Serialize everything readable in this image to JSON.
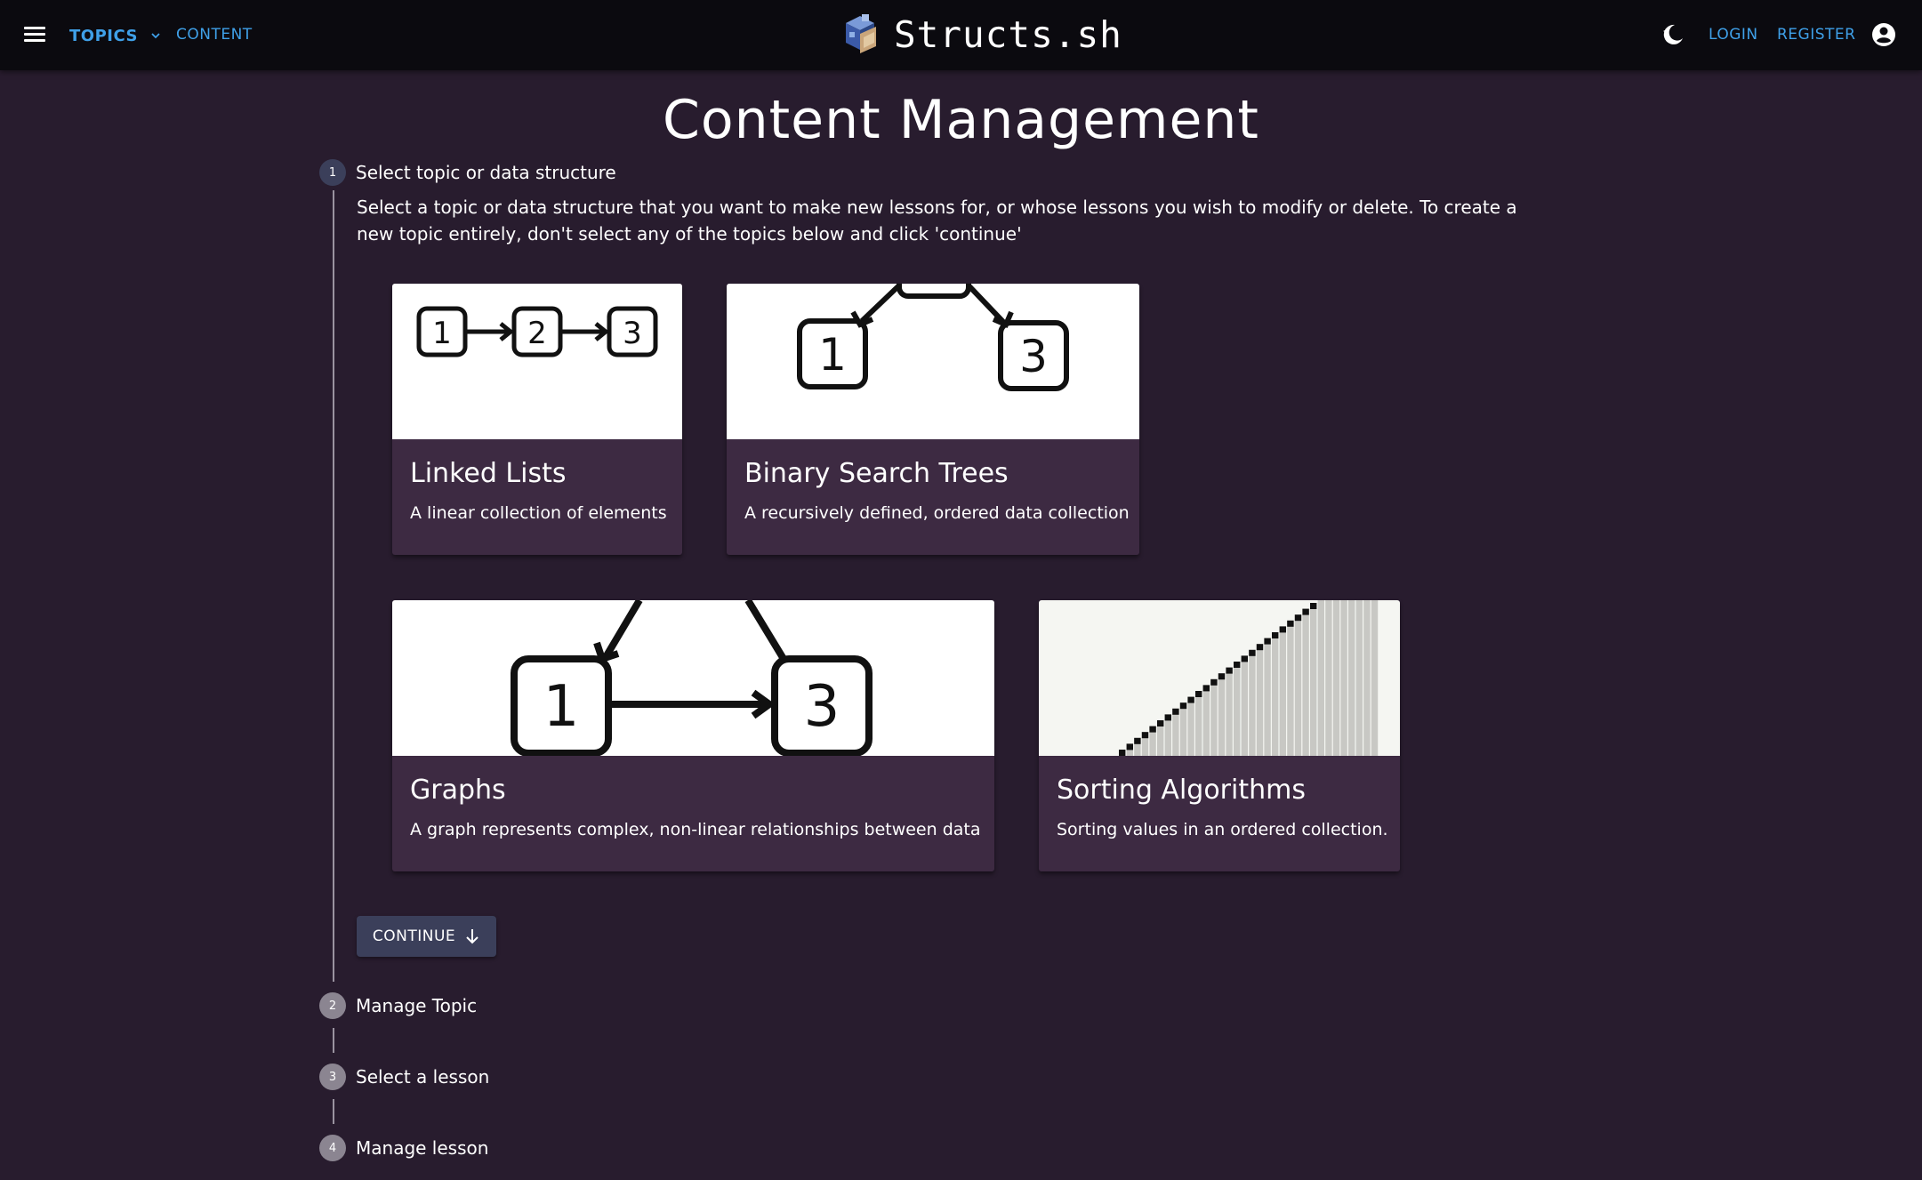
{
  "header": {
    "menu_icon": "hamburger-menu-icon",
    "topics_label": "TOPICS",
    "content_label": "CONTENT",
    "brand_name": "Structs.sh",
    "login_label": "LOGIN",
    "register_label": "REGISTER",
    "theme_icon": "dark-mode-toggle-icon",
    "account_icon": "account-circle-icon",
    "link_color": "#3fa0e8"
  },
  "page": {
    "title": "Content Management"
  },
  "stepper": {
    "steps": [
      {
        "number": "1",
        "label": "Select topic or data structure",
        "state": "active"
      },
      {
        "number": "2",
        "label": "Manage Topic",
        "state": "inactive"
      },
      {
        "number": "3",
        "label": "Select a lesson",
        "state": "inactive"
      },
      {
        "number": "4",
        "label": "Manage lesson",
        "state": "inactive"
      }
    ],
    "step1_description": "Select a topic or data structure that you want to make new lessons for, or whose lessons you wish to modify or delete. To create a new topic entirely, don't select any of the topics below and click 'continue'"
  },
  "topics": [
    {
      "title": "Linked Lists",
      "description": "A linear collection of elements",
      "image": "linked-list-diagram"
    },
    {
      "title": "Binary Search Trees",
      "description": "A recursively defined, ordered data collection",
      "image": "bst-diagram"
    },
    {
      "title": "Graphs",
      "description": "A graph represents complex, non-linear relationships between data",
      "image": "graph-diagram"
    },
    {
      "title": "Sorting Algorithms",
      "description": "Sorting values in an ordered collection.",
      "image": "sorting-bars-diagram"
    }
  ],
  "actions": {
    "continue_label": "CONTINUE",
    "continue_icon": "arrow-down-icon"
  },
  "colors": {
    "background": "#281c2e",
    "appbar": "#0b0a0f",
    "card": "#3d2a42",
    "step_active": "#3b3f5a",
    "step_inactive": "#8b8591"
  }
}
